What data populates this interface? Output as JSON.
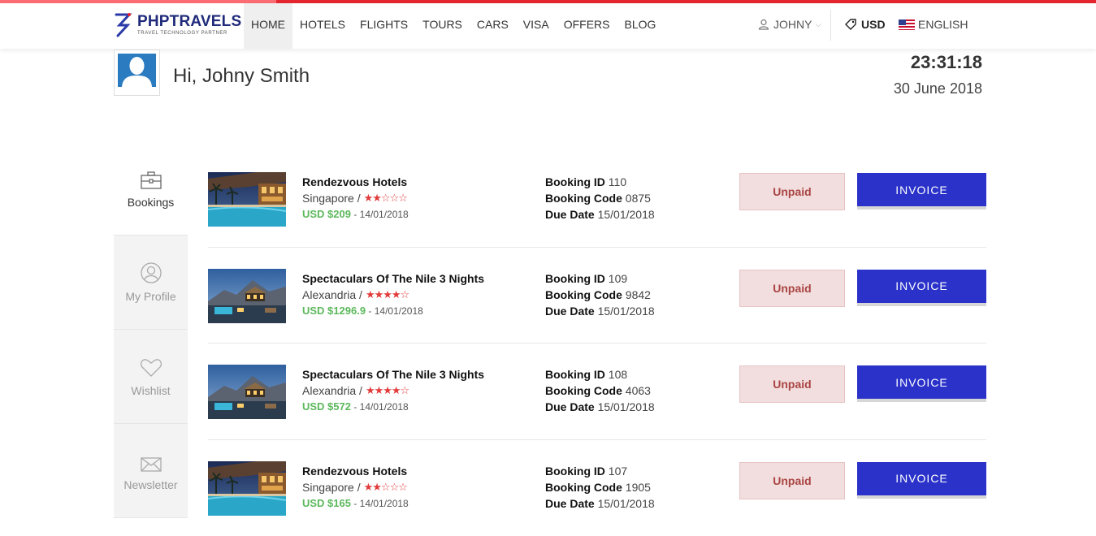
{
  "nav": {
    "brand": "PHPTRAVELS",
    "tagline": "TRAVEL TECHNOLOGY PARTNER",
    "menu": [
      "HOME",
      "HOTELS",
      "FLIGHTS",
      "TOURS",
      "CARS",
      "VISA",
      "OFFERS",
      "BLOG"
    ],
    "active_menu": "HOME",
    "user": "JOHNY",
    "currency": "USD",
    "language": "ENGLISH"
  },
  "header": {
    "greeting": "Hi, Johny Smith",
    "time": "23:31:18",
    "date": "30 June 2018"
  },
  "sidebar": {
    "tabs": [
      {
        "label": "Bookings",
        "icon": "briefcase-icon",
        "active": true
      },
      {
        "label": "My Profile",
        "icon": "user-circle-icon",
        "active": false
      },
      {
        "label": "Wishlist",
        "icon": "heart-icon",
        "active": false
      },
      {
        "label": "Newsletter",
        "icon": "envelope-icon",
        "active": false
      }
    ]
  },
  "labels": {
    "booking_id": "Booking ID",
    "booking_code": "Booking Code",
    "due_date": "Due Date",
    "unpaid": "Unpaid",
    "invoice": "INVOICE"
  },
  "bookings": [
    {
      "title": "Rendezvous Hotels",
      "location": "Singapore /",
      "stars": 2,
      "price": "USD $209",
      "date": "- 14/01/2018",
      "id": "110",
      "code": "0875",
      "due": "15/01/2018",
      "image": "hotel-pool"
    },
    {
      "title": "Spectaculars Of The Nile 3 Nights",
      "location": "Alexandria /",
      "stars": 4,
      "price": "USD $1296.9",
      "date": "- 14/01/2018",
      "id": "109",
      "code": "9842",
      "due": "15/01/2018",
      "image": "mountain-resort"
    },
    {
      "title": "Spectaculars Of The Nile 3 Nights",
      "location": "Alexandria /",
      "stars": 4,
      "price": "USD $572",
      "date": "- 14/01/2018",
      "id": "108",
      "code": "4063",
      "due": "15/01/2018",
      "image": "mountain-resort"
    },
    {
      "title": "Rendezvous Hotels",
      "location": "Singapore /",
      "stars": 2,
      "price": "USD $165",
      "date": "- 14/01/2018",
      "id": "107",
      "code": "1905",
      "due": "15/01/2018",
      "image": "hotel-pool"
    }
  ]
}
